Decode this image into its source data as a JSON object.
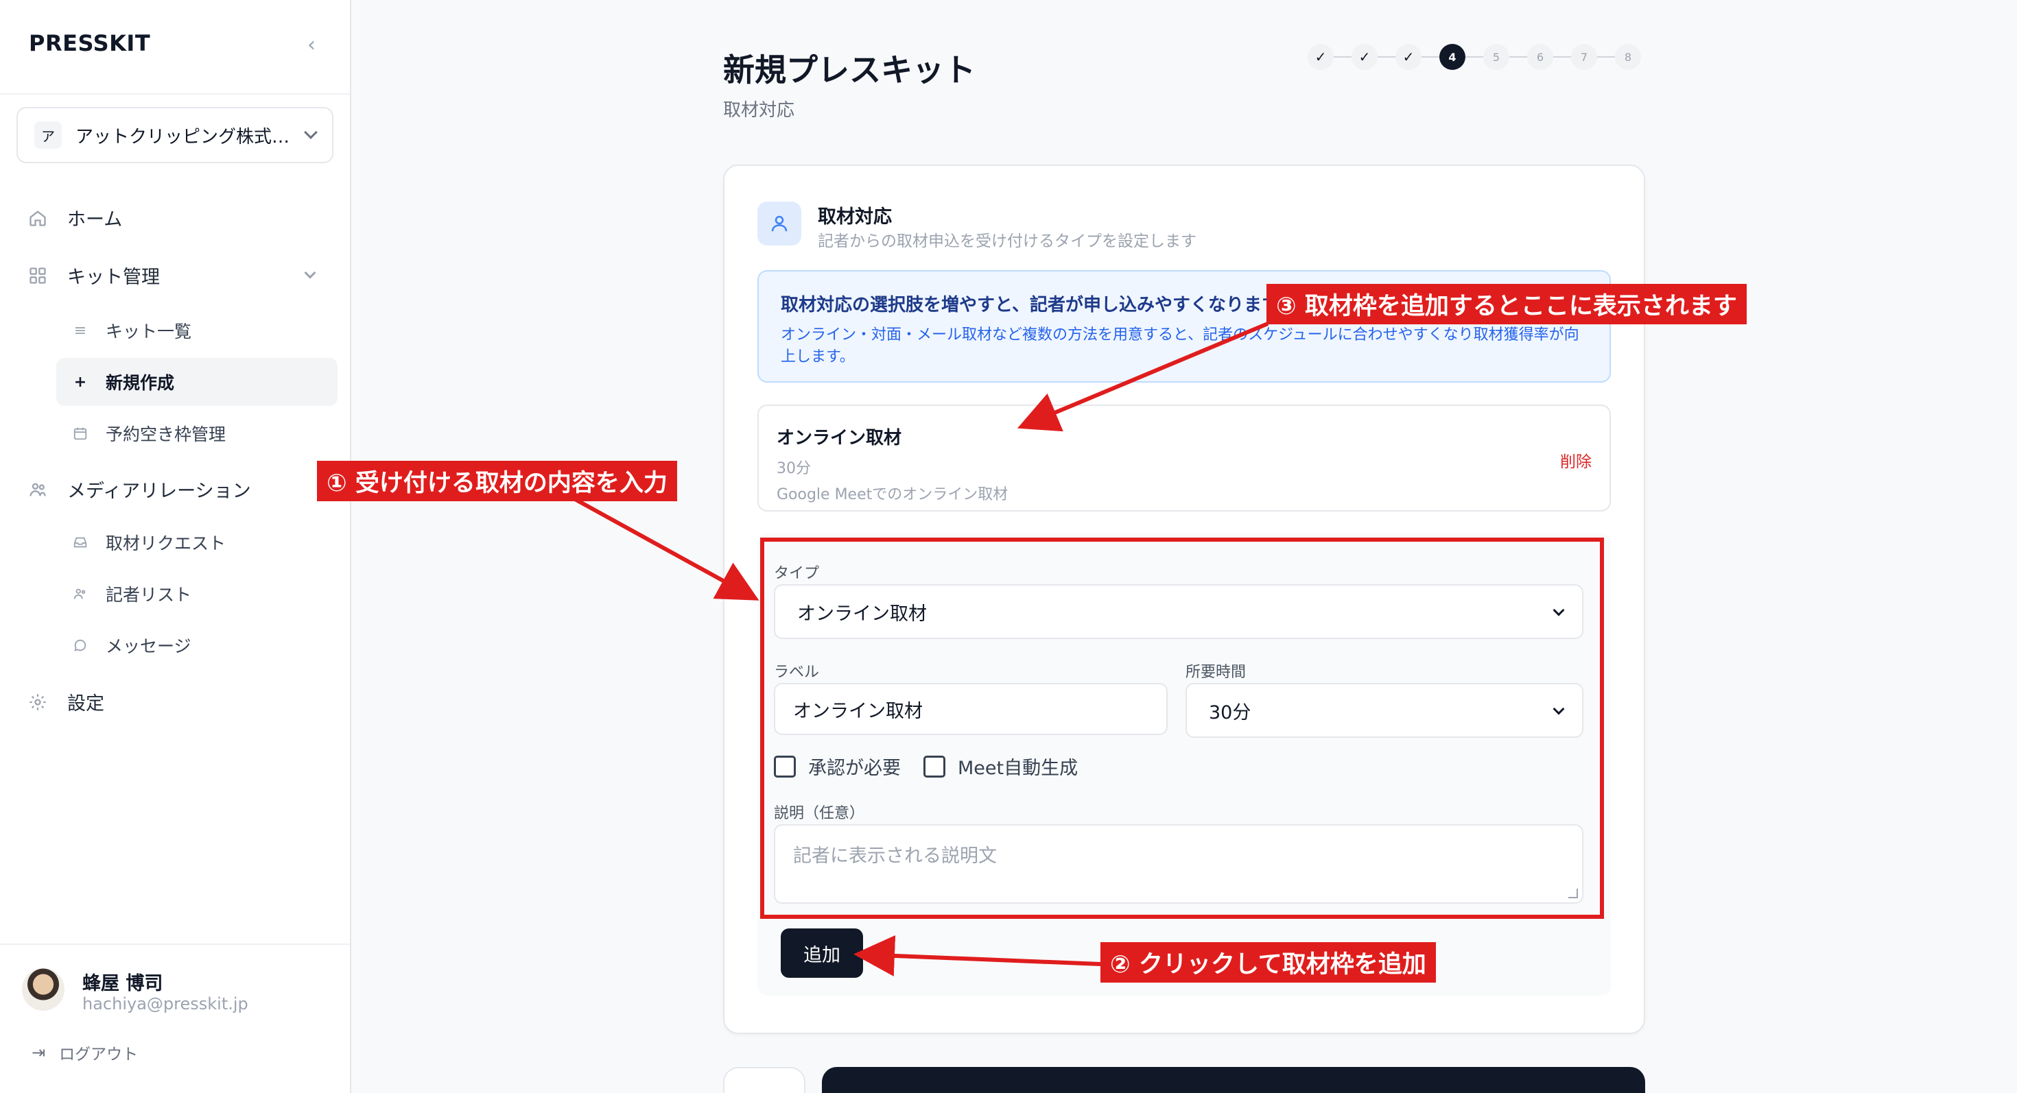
{
  "sidebar": {
    "brand": "PRESSKIT",
    "org": {
      "avatar": "ア",
      "name": "アットクリッピング株式…"
    },
    "nav": {
      "home": "ホーム",
      "kit_management": "キット管理",
      "kit_list": "キット一覧",
      "new_create": "新規作成",
      "slot_management": "予約空き枠管理",
      "media_relations": "メディアリレーション",
      "requests": "取材リクエスト",
      "journalists": "記者リスト",
      "messages": "メッセージ",
      "settings": "設定"
    },
    "user": {
      "name": "蜂屋 博司",
      "email": "hachiya@presskit.jp"
    },
    "logout": "ログアウト"
  },
  "header": {
    "title": "新規プレスキット",
    "subtitle": "取材対応"
  },
  "stepper": {
    "steps": [
      "✓",
      "✓",
      "✓",
      "4",
      "5",
      "6",
      "7",
      "8"
    ],
    "current": 4
  },
  "section": {
    "title": "取材対応",
    "description": "記者からの取材申込を受け付けるタイプを設定します",
    "tip_title": "取材対応の選択肢を増やすと、記者が申し込みやすくなります",
    "tip_body": "オンライン・対面・メール取材など複数の方法を用意すると、記者のスケジュールに合わせやすくなり取材獲得率が向上します。"
  },
  "slot": {
    "title": "オンライン取材",
    "duration": "30分",
    "description": "Google Meetでのオンライン取材",
    "delete_label": "削除"
  },
  "form": {
    "type_label": "タイプ",
    "type_value": "オンライン取材",
    "label_label": "ラベル",
    "label_value": "オンライン取材",
    "duration_label": "所要時間",
    "duration_value": "30分",
    "approval_label": "承認が必要",
    "meet_label": "Meet自動生成",
    "desc_label": "説明（任意）",
    "desc_placeholder": "記者に表示される説明文",
    "add_button": "追加"
  },
  "annotations": {
    "a1": "① 受け付ける取材の内容を入力",
    "a2": "② クリックして取材枠を追加",
    "a3": "③ 取材枠を追加するとここに表示されます"
  },
  "colors": {
    "accent_dark": "#111827",
    "annotation_red": "#e01d1d",
    "tip_bg": "#eff6ff",
    "delete_red": "#dc2626"
  }
}
